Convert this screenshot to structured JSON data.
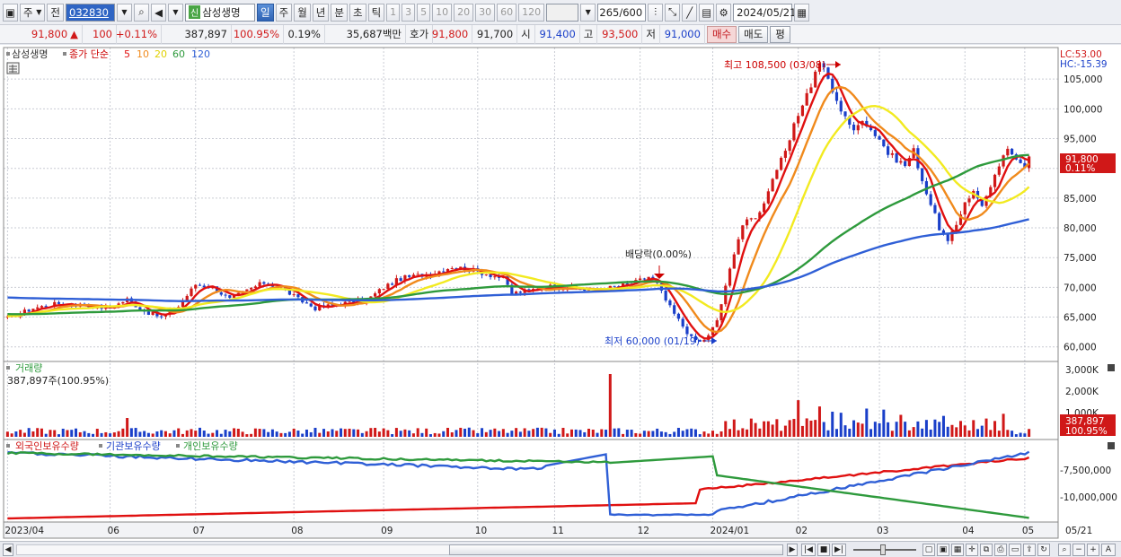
{
  "toolbar": {
    "market": "주",
    "prev": "전",
    "code": "032830",
    "name": "삼성생명",
    "shin": "신",
    "periods": [
      "일",
      "주",
      "월",
      "년",
      "분",
      "초",
      "틱"
    ],
    "intervals": [
      "1",
      "3",
      "5",
      "10",
      "20",
      "30",
      "60",
      "120"
    ],
    "count": "265",
    "count_total": "/600",
    "date": "2024/05/21"
  },
  "quote": {
    "price": "91,800",
    "arrow": "▲",
    "change": "100",
    "rate": "+0.11%",
    "volume": "387,897",
    "vol_rate": "100.95%",
    "turnover": "0.19%",
    "amount": "35,687백만",
    "hoga_label": "호가",
    "ask": "91,800",
    "bid": "91,700",
    "open_label": "시",
    "open": "91,400",
    "high_label": "고",
    "high": "93,500",
    "low_label": "저",
    "low": "91,000",
    "buy": "매수",
    "sell": "매도",
    "avg": "평"
  },
  "legend": {
    "stock": "삼성생명",
    "label": "종가 단순",
    "ma": [
      "5",
      "10",
      "20",
      "60",
      "120"
    ]
  },
  "colors": {
    "up": "#d01818",
    "down": "#1a3fc9",
    "ma5": "#e01010",
    "ma10": "#f08a1c",
    "ma20": "#f2ea20",
    "ma60": "#2e9a3c",
    "ma120": "#2f5fd6",
    "grid": "#c9ccd4"
  },
  "chart_data": {
    "type": "candlestick",
    "ylim": [
      58000,
      110000
    ],
    "yticks": [
      "105,000",
      "100,000",
      "95,000",
      "90,000",
      "85,000",
      "80,000",
      "75,000",
      "70,000",
      "65,000",
      "60,000"
    ],
    "lc": "LC:53.00",
    "hc": "HC:-15.39",
    "cur_price": "91,800",
    "cur_rate": "0.11%",
    "high_note": "최고 108,500 (03/08)",
    "low_note": "최저 60,000 (01/19)",
    "div_note": "배당락(0.00%)",
    "months": [
      "2023/04",
      "06",
      "07",
      "08",
      "09",
      "10",
      "11",
      "12",
      "2024/01",
      "02",
      "03",
      "04",
      "05",
      "05/21"
    ],
    "close_path": [
      [
        0,
        64800
      ],
      [
        6,
        66500
      ],
      [
        12,
        67300
      ],
      [
        18,
        67000
      ],
      [
        24,
        66500
      ],
      [
        28,
        68000
      ],
      [
        32,
        66000
      ],
      [
        36,
        65000
      ],
      [
        40,
        66800
      ],
      [
        44,
        70500
      ],
      [
        48,
        70000
      ],
      [
        52,
        68000
      ],
      [
        56,
        69500
      ],
      [
        60,
        70800
      ],
      [
        64,
        70000
      ],
      [
        68,
        68000
      ],
      [
        72,
        66500
      ],
      [
        76,
        67000
      ],
      [
        80,
        67500
      ],
      [
        84,
        67800
      ],
      [
        88,
        70000
      ],
      [
        92,
        71500
      ],
      [
        96,
        72000
      ],
      [
        100,
        72500
      ],
      [
        104,
        73500
      ],
      [
        108,
        73000
      ],
      [
        112,
        72300
      ],
      [
        116,
        71500
      ],
      [
        118,
        69000
      ],
      [
        122,
        69500
      ],
      [
        126,
        70200
      ],
      [
        130,
        70000
      ],
      [
        134,
        69700
      ],
      [
        138,
        69500
      ],
      [
        142,
        70100
      ],
      [
        146,
        70600
      ],
      [
        150,
        71800
      ],
      [
        152,
        70500
      ],
      [
        154,
        67800
      ],
      [
        156,
        65500
      ],
      [
        158,
        63500
      ],
      [
        160,
        61500
      ],
      [
        162,
        60800
      ],
      [
        164,
        61800
      ],
      [
        166,
        64500
      ],
      [
        168,
        70000
      ],
      [
        170,
        76000
      ],
      [
        172,
        80500
      ],
      [
        176,
        82500
      ],
      [
        178,
        86500
      ],
      [
        180,
        90000
      ],
      [
        182,
        92500
      ],
      [
        184,
        97000
      ],
      [
        186,
        101000
      ],
      [
        188,
        104000
      ],
      [
        190,
        108000
      ],
      [
        192,
        105000
      ],
      [
        194,
        101000
      ],
      [
        196,
        99000
      ],
      [
        198,
        96000
      ],
      [
        200,
        98500
      ],
      [
        202,
        96500
      ],
      [
        204,
        95000
      ],
      [
        206,
        92500
      ],
      [
        208,
        91500
      ],
      [
        210,
        90500
      ],
      [
        212,
        93000
      ],
      [
        214,
        88000
      ],
      [
        216,
        84000
      ],
      [
        218,
        80000
      ],
      [
        220,
        77500
      ],
      [
        222,
        80500
      ],
      [
        224,
        84500
      ],
      [
        226,
        86000
      ],
      [
        228,
        84000
      ],
      [
        230,
        86500
      ],
      [
        232,
        90500
      ],
      [
        234,
        93000
      ],
      [
        236,
        92000
      ],
      [
        238,
        90500
      ],
      [
        239,
        91800
      ]
    ],
    "volume_label": "거래량",
    "volume_sub": "387,897주(100.95%)",
    "vol_ticks": [
      "3,000K",
      "2,000K",
      "1,000K"
    ],
    "vol_now": "387,897",
    "vol_now_rate": "100.95%",
    "vol_spikes": [
      [
        28,
        900
      ],
      [
        141,
        3000
      ],
      [
        185,
        1750
      ],
      [
        190,
        1450
      ],
      [
        193,
        1200
      ],
      [
        195,
        1150
      ],
      [
        201,
        1350
      ],
      [
        205,
        1300
      ],
      [
        209,
        1050
      ],
      [
        219,
        1000
      ],
      [
        233,
        1100
      ]
    ],
    "holdings_legend": [
      "외국인보유수량",
      "기관보유수량",
      "개인보유수량"
    ],
    "hold_ticks": [
      "-7,500,000",
      "-10,000,000"
    ]
  },
  "nav": {
    "first": "|◀",
    "prev": "◀",
    "stop": "■",
    "next": "▶",
    "last": "▶|"
  }
}
